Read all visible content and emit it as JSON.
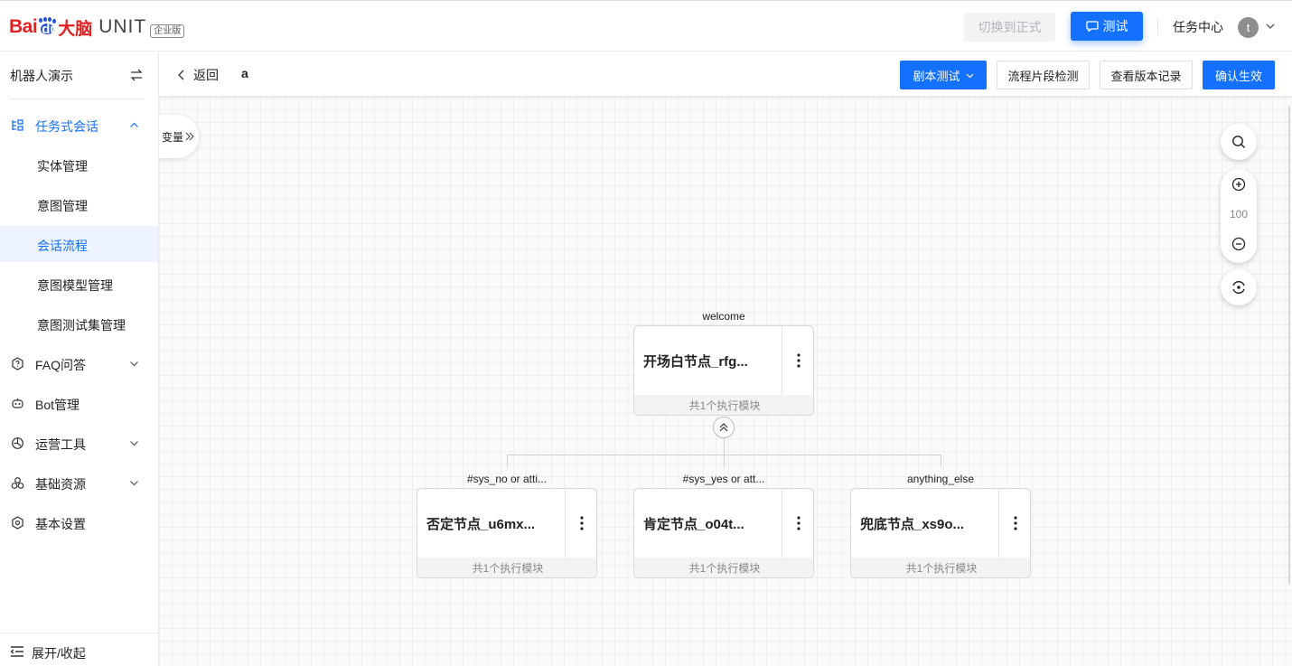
{
  "brand": {
    "bai": "Bai",
    "du": "du",
    "danao": "大脑",
    "unit": "UNIT",
    "edition": "企业版"
  },
  "header": {
    "switch_label": "切换到正式",
    "test_label": "测试",
    "task_center": "任务中心",
    "avatar_initial": "t"
  },
  "sidebar": {
    "robot_name": "机器人演示",
    "items": [
      {
        "label": "任务式会话",
        "icon": "flow-tree-icon",
        "expanded": true
      },
      {
        "label": "实体管理"
      },
      {
        "label": "意图管理"
      },
      {
        "label": "会话流程",
        "selected": true
      },
      {
        "label": "意图模型管理"
      },
      {
        "label": "意图测试集管理"
      },
      {
        "label": "FAQ问答",
        "icon": "faq-hex-icon"
      },
      {
        "label": "Bot管理",
        "icon": "bot-icon"
      },
      {
        "label": "运营工具",
        "icon": "ops-icon"
      },
      {
        "label": "基础资源",
        "icon": "resource-icon"
      },
      {
        "label": "基本设置",
        "icon": "settings-icon"
      }
    ],
    "collapse_label": "展开/收起"
  },
  "toolbar": {
    "back_label": "返回",
    "flow_name": "a",
    "script_test": "剧本测试",
    "segment_check": "流程片段检测",
    "version_history": "查看版本记录",
    "confirm": "确认生效"
  },
  "canvas": {
    "variables_tab": "变量",
    "zoom_level": "100",
    "nodes": [
      {
        "condition": "welcome",
        "title": "开场白节点_rfg...",
        "footer": "共1个执行模块"
      },
      {
        "condition": "#sys_no or atti...",
        "title": "否定节点_u6mx...",
        "footer": "共1个执行模块"
      },
      {
        "condition": "#sys_yes or att...",
        "title": "肯定节点_o04t...",
        "footer": "共1个执行模块"
      },
      {
        "condition": "anything_else",
        "title": "兜底节点_xs9o...",
        "footer": "共1个执行模块"
      }
    ]
  },
  "colors": {
    "primary": "#1470ff",
    "brand_red": "#e22020",
    "brand_blue": "#2552d8",
    "selected_bg": "#edf3ff"
  }
}
